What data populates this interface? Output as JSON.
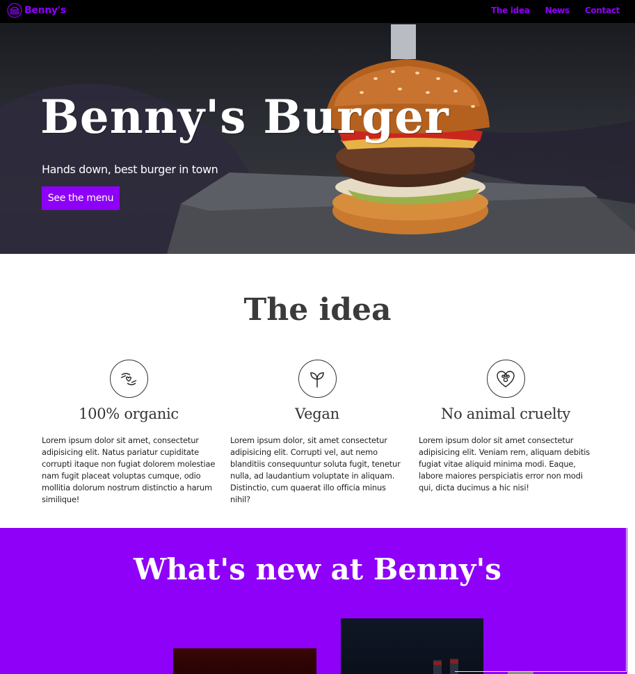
{
  "brand": {
    "name": "Benny's"
  },
  "nav": {
    "links": [
      "The idea",
      "News",
      "Contact"
    ]
  },
  "hero": {
    "title": "Benny's Burger",
    "subtitle": "Hands down, best burger in town",
    "button": "See the menu"
  },
  "idea": {
    "title": "The idea",
    "features": [
      {
        "icon": "hands-heart-icon",
        "title": "100% organic",
        "text": "Lorem ipsum dolor sit amet, consectetur adipisicing elit. Natus pariatur cupiditate corrupti itaque non fugiat dolorem molestiae nam fugit placeat voluptas cumque, odio mollitia dolorum nostrum distinctio a harum similique!"
      },
      {
        "icon": "sprout-icon",
        "title": "Vegan",
        "text": "Lorem ipsum dolor, sit amet consectetur adipisicing elit. Corrupti vel, aut nemo blanditiis consequuntur soluta fugit, tenetur nulla, ad laudantium voluptate in aliquam. Distinctio, cum quaerat illo officia minus nihil?"
      },
      {
        "icon": "heart-paw-icon",
        "title": "No animal cruelty",
        "text": "Lorem ipsum dolor sit amet consectetur adipisicing elit. Veniam rem, aliquam debitis fugiat vitae aliquid minima modi. Eaque, labore maiores perspiciatis error non modi qui, dicta ducimus a hic nisi!"
      }
    ]
  },
  "news": {
    "title": "What's new at Benny's"
  },
  "colors": {
    "accent": "#8e00f7",
    "navbar": "#000000",
    "heading": "#3b3b3b"
  }
}
